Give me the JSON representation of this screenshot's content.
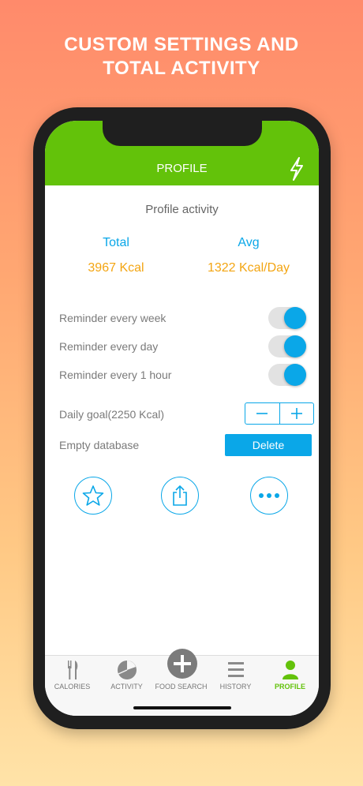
{
  "promo": {
    "line1": "CUSTOM SETTINGS AND",
    "line2": "TOTAL ACTIVITY"
  },
  "header": {
    "title": "PROFILE"
  },
  "profile": {
    "section_title": "Profile activity",
    "total_label": "Total",
    "total_value": "3967 Kcal",
    "avg_label": "Avg",
    "avg_value": "1322 Kcal/Day"
  },
  "settings": {
    "reminder_week": "Reminder every week",
    "reminder_day": "Reminder every day",
    "reminder_hour": "Reminder every 1 hour",
    "daily_goal": "Daily goal(2250 Kcal)",
    "empty_db": "Empty database",
    "delete_label": "Delete"
  },
  "tabs": [
    {
      "label": "CALORIES"
    },
    {
      "label": "ACTIVITY"
    },
    {
      "label": "FOOD SEARCH"
    },
    {
      "label": "HISTORY"
    },
    {
      "label": "PROFILE"
    }
  ],
  "colors": {
    "green": "#63c20a",
    "blue": "#0aa7e8",
    "orange": "#f3a512"
  }
}
